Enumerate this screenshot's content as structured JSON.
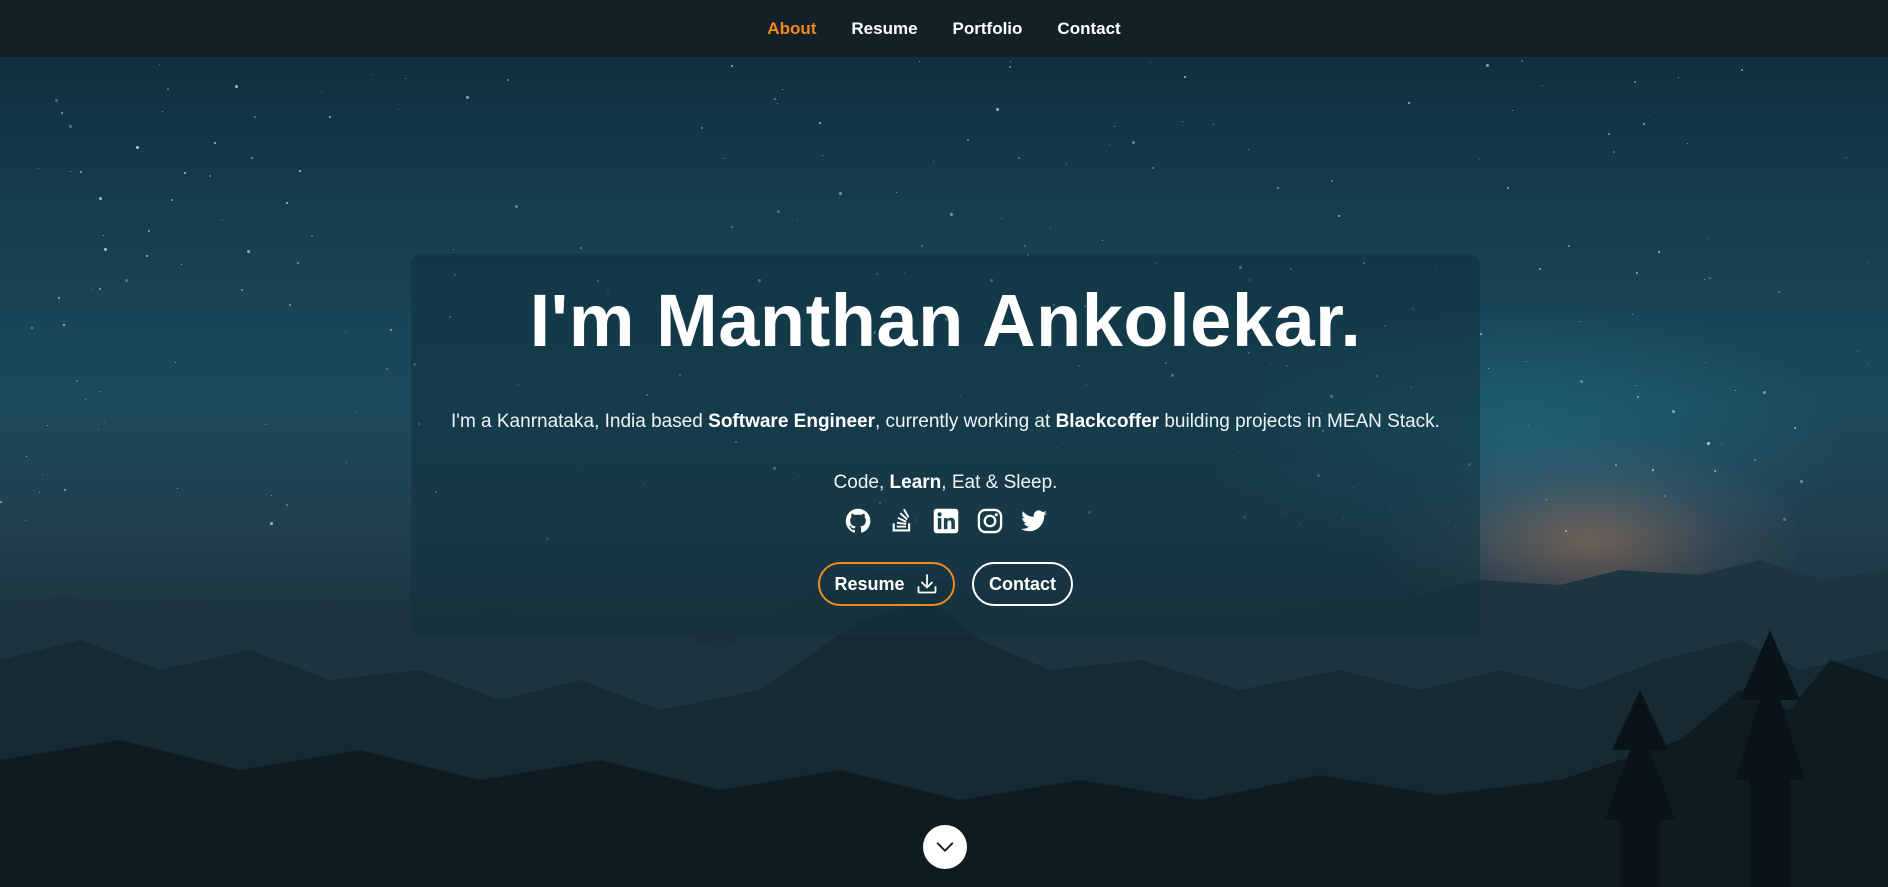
{
  "nav": {
    "items": [
      {
        "label": "About",
        "active": true
      },
      {
        "label": "Resume",
        "active": false
      },
      {
        "label": "Portfolio",
        "active": false
      },
      {
        "label": "Contact",
        "active": false
      }
    ]
  },
  "hero": {
    "title": "I'm Manthan Ankolekar.",
    "intro": {
      "part1": "I'm a Kanrnataka, India based ",
      "role": "Software Engineer",
      "part2": ", currently working at ",
      "company": "Blackcoffer",
      "part3": " building projects in MEAN Stack."
    },
    "motto": {
      "part1": "Code, ",
      "bold": "Learn",
      "part2": ", Eat & Sleep."
    },
    "socials": [
      {
        "icon": "github-icon"
      },
      {
        "icon": "stackoverflow-icon"
      },
      {
        "icon": "linkedin-icon"
      },
      {
        "icon": "instagram-icon"
      },
      {
        "icon": "twitter-icon"
      }
    ],
    "buttons": {
      "resume_label": "Resume",
      "contact_label": "Contact"
    }
  },
  "scroll": {
    "icon": "chevron-down-icon"
  },
  "colors": {
    "accent": "#f08a1c",
    "navbar": "#142026",
    "text": "#ffffff"
  }
}
